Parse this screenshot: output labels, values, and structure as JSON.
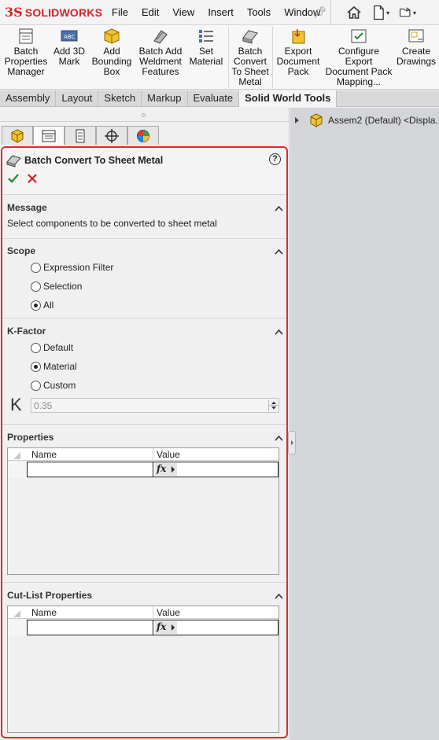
{
  "app": {
    "logo_mark": "3S",
    "logo_text": "SOLIDWORKS"
  },
  "menu": [
    "File",
    "Edit",
    "View",
    "Insert",
    "Tools",
    "Window"
  ],
  "ribbon": {
    "buttons": [
      {
        "label": "Batch Properties Manager",
        "lines": [
          "Batch",
          "Properties",
          "Manager"
        ]
      },
      {
        "label": "Add 3D Mark",
        "lines": [
          "Add 3D",
          "Mark"
        ]
      },
      {
        "label": "Add Bounding Box",
        "lines": [
          "Add",
          "Bounding",
          "Box"
        ]
      },
      {
        "label": "Batch Add Weldment Features",
        "lines": [
          "Batch Add",
          "Weldment",
          "Features"
        ]
      },
      {
        "label": "Set Material",
        "lines": [
          "Set",
          "Material"
        ]
      },
      {
        "label": "Batch Convert To Sheet Metal",
        "lines": [
          "Batch",
          "Convert",
          "To Sheet",
          "Metal"
        ]
      },
      {
        "label": "Export Document Pack",
        "lines": [
          "Export",
          "Document",
          "Pack"
        ]
      },
      {
        "label": "Configure Export Document Pack Mapping...",
        "lines": [
          "Configure",
          "Export",
          "Document Pack",
          "Mapping..."
        ]
      },
      {
        "label": "Create Drawings",
        "lines": [
          "Create",
          "Drawings"
        ]
      }
    ]
  },
  "tabs": [
    {
      "label": "Assembly",
      "active": false
    },
    {
      "label": "Layout",
      "active": false
    },
    {
      "label": "Sketch",
      "active": false
    },
    {
      "label": "Markup",
      "active": false
    },
    {
      "label": "Evaluate",
      "active": false
    },
    {
      "label": "Solid World Tools",
      "active": true
    }
  ],
  "property_manager": {
    "title": "Batch Convert To Sheet Metal",
    "help": "?",
    "message": {
      "title": "Message",
      "text": "Select components to be converted to sheet metal"
    },
    "scope": {
      "title": "Scope",
      "options": [
        {
          "label": "Expression Filter",
          "selected": false
        },
        {
          "label": "Selection",
          "selected": false
        },
        {
          "label": "All",
          "selected": true
        }
      ]
    },
    "kfactor": {
      "title": "K-Factor",
      "options": [
        {
          "label": "Default",
          "selected": false
        },
        {
          "label": "Material",
          "selected": true
        },
        {
          "label": "Custom",
          "selected": false
        }
      ],
      "symbol": "K",
      "value": "0.35"
    },
    "properties": {
      "title": "Properties",
      "col_name": "Name",
      "col_value": "Value",
      "fx": "fx"
    },
    "cutlist": {
      "title": "Cut-List Properties",
      "col_name": "Name",
      "col_value": "Value",
      "fx": "fx"
    }
  },
  "tree": {
    "root": "Assem2 (Default) <Displa..."
  }
}
